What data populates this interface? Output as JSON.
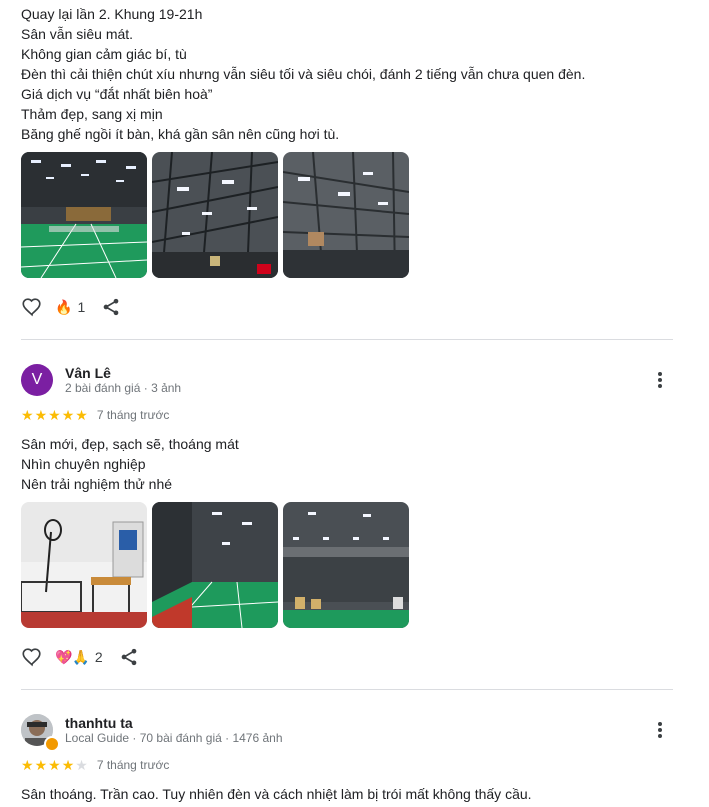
{
  "review1": {
    "lines": [
      "Quay lại lần 2. Khung 19-21h",
      "Sân vẫn siêu mát.",
      "Không gian cảm giác bí, tù",
      "Đèn thì cải thiện chút xíu nhưng vẫn siêu tối và siêu chói, đánh 2 tiếng vẫn chưa quen đèn.",
      "Giá dịch vụ “đắt nhất biên hoà”",
      "Thảm đẹp, sang xị mịn",
      "Băng ghế ngồi ít bàn, khá gần sân nên cũng hơi tù."
    ],
    "reaction_emoji": "🔥",
    "reaction_count": "1"
  },
  "review2": {
    "avatar_letter": "V",
    "avatar_color": "#7b1fa2",
    "name": "Vân Lê",
    "meta": "2 bài đánh giá · 3 ảnh",
    "rating": 5,
    "date": "7 tháng trước",
    "lines": [
      "Sân mới, đẹp, sạch sẽ, thoáng mát",
      "Nhìn chuyên nghiệp",
      "Nên trải nghiệm thử nhé"
    ],
    "reaction_emoji": "💖🙏",
    "reaction_count": "2"
  },
  "review3": {
    "name": "thanhtu ta",
    "meta": "Local Guide · 70 bài đánh giá · 1476 ảnh",
    "rating": 4,
    "date": "7 tháng trước",
    "lines": [
      "Sân thoáng. Trần cao. Tuy nhiên đèn và cách nhiệt làm bị trói mất không thấy cầu."
    ]
  },
  "colors": {
    "star": "#fbbc04",
    "court_green": "#1e9a5a",
    "court_red": "#c0392b"
  }
}
